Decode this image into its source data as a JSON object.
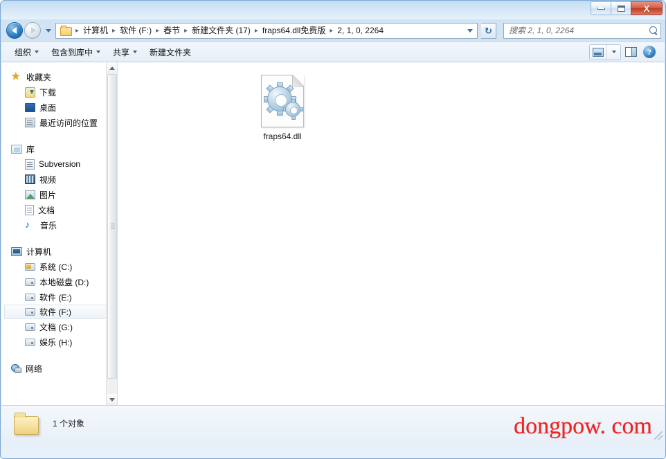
{
  "window": {
    "title": "",
    "controls": {
      "minimize": "—",
      "maximize": "□",
      "close": "X"
    }
  },
  "nav": {
    "back_tooltip": "后退",
    "forward_tooltip": "前进",
    "history_tooltip": "最近浏览的位置",
    "refresh_tooltip": "刷新"
  },
  "address": {
    "crumbs": [
      "计算机",
      "软件 (F:)",
      "春节",
      "新建文件夹 (17)",
      "fraps64.dll免费版",
      "2, 1, 0, 2264"
    ],
    "separator": "▸"
  },
  "search": {
    "placeholder": "搜索 2, 1, 0, 2264",
    "value": "",
    "icon": "search-icon"
  },
  "toolbar": {
    "items": [
      {
        "label": "组织",
        "has_caret": true
      },
      {
        "label": "包含到库中",
        "has_caret": true
      },
      {
        "label": "共享",
        "has_caret": true
      },
      {
        "label": "新建文件夹",
        "has_caret": false
      }
    ],
    "right": {
      "view_icon": "view-mode-icon",
      "view_caret": "chevron-down-icon",
      "preview_pane_icon": "preview-pane-icon",
      "help_icon": "help-icon",
      "help_glyph": "?"
    }
  },
  "sidebar": {
    "groups": [
      {
        "header": {
          "label": "收藏夹",
          "icon": "favorites-star-icon"
        },
        "items": [
          {
            "label": "下载",
            "icon": "downloads-icon"
          },
          {
            "label": "桌面",
            "icon": "desktop-icon"
          },
          {
            "label": "最近访问的位置",
            "icon": "recent-places-icon"
          }
        ]
      },
      {
        "header": {
          "label": "库",
          "icon": "libraries-icon"
        },
        "items": [
          {
            "label": "Subversion",
            "icon": "subversion-icon"
          },
          {
            "label": "视频",
            "icon": "videos-icon"
          },
          {
            "label": "图片",
            "icon": "pictures-icon"
          },
          {
            "label": "文档",
            "icon": "documents-icon"
          },
          {
            "label": "音乐",
            "icon": "music-icon"
          }
        ]
      },
      {
        "header": {
          "label": "计算机",
          "icon": "computer-icon"
        },
        "items": [
          {
            "label": "系统 (C:)",
            "icon": "system-drive-icon",
            "selected": false
          },
          {
            "label": "本地磁盘 (D:)",
            "icon": "drive-icon",
            "selected": false
          },
          {
            "label": "软件 (E:)",
            "icon": "drive-icon",
            "selected": false
          },
          {
            "label": "软件 (F:)",
            "icon": "drive-icon",
            "selected": true
          },
          {
            "label": "文档 (G:)",
            "icon": "drive-icon",
            "selected": false
          },
          {
            "label": "娱乐 (H:)",
            "icon": "drive-icon",
            "selected": false
          }
        ]
      },
      {
        "header": {
          "label": "网络",
          "icon": "network-icon"
        },
        "items": []
      }
    ],
    "music_glyph": "♪"
  },
  "content": {
    "files": [
      {
        "name": "fraps64.dll",
        "icon": "dll-gear-icon"
      }
    ]
  },
  "status": {
    "folder_icon": "folder-icon",
    "text": "1 个对象"
  },
  "watermark": {
    "text": "dongpow. com",
    "color": "#ef2222"
  },
  "colors": {
    "titlebar": "#cfe2f3",
    "frame_border": "#7ba7d4",
    "close_button": "#bf3c22",
    "selection": "#eef3f8",
    "watermark": "#ef2222"
  }
}
